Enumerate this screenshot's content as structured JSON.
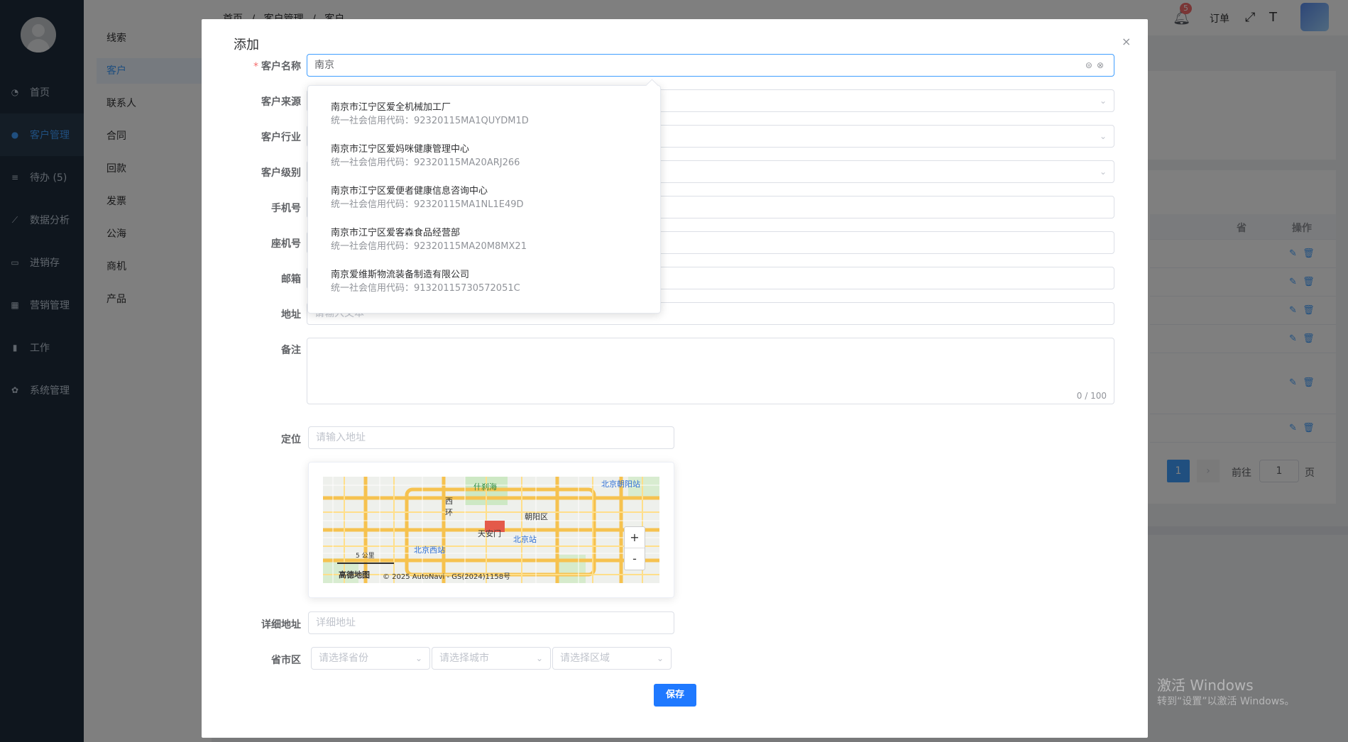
{
  "sidebar": {
    "items": [
      {
        "label": "首页",
        "icon": "dashboard-icon"
      },
      {
        "label": "客户管理",
        "icon": "user-icon"
      },
      {
        "label": "待办 (5)",
        "icon": "sliders-icon"
      },
      {
        "label": "数据分析",
        "icon": "chart-icon"
      },
      {
        "label": "进销存",
        "icon": "box-icon"
      },
      {
        "label": "营销管理",
        "icon": "calculator-icon"
      },
      {
        "label": "工作",
        "icon": "book-icon"
      },
      {
        "label": "系统管理",
        "icon": "gear-icon"
      }
    ]
  },
  "submenu": {
    "items": [
      "线索",
      "客户",
      "联系人",
      "合同",
      "回款",
      "发票",
      "公海",
      "商机",
      "产品"
    ]
  },
  "topbar": {
    "breadcrumb": [
      "首页",
      "/",
      "客户管理",
      "/",
      "客户"
    ],
    "badge": "5",
    "order_label": "订单"
  },
  "table": {
    "col_province": "省",
    "col_action": "操作"
  },
  "pagination": {
    "current": "1",
    "goto_label": "前往",
    "goto_value": "1",
    "unit": "页"
  },
  "watermark": {
    "line1": "激活 Windows",
    "line2": "转到“设置”以激活 Windows。"
  },
  "dialog": {
    "title": "添加",
    "close": "×",
    "fields": {
      "name_label": "客户名称",
      "name_value": "南京",
      "source_label": "客户来源",
      "industry_label": "客户行业",
      "level_label": "客户级别",
      "phone_label": "手机号",
      "landline_label": "座机号",
      "email_label": "邮箱",
      "address_label": "地址",
      "address_placeholder": "请输入文本",
      "remark_label": "备注",
      "remark_counter": "0 / 100",
      "location_label": "定位",
      "location_placeholder": "请输入地址",
      "detail_label": "详细地址",
      "detail_placeholder": "详细地址",
      "region_label": "省市区",
      "province_placeholder": "请选择省份",
      "city_placeholder": "请选择城市",
      "district_placeholder": "请选择区域"
    },
    "save_label": "保存"
  },
  "suggestions": [
    {
      "name": "南京市江宁区爱全机械加工厂",
      "code": "统一社会信用代码：92320115MA1QUYDM1D"
    },
    {
      "name": "南京市江宁区爱妈咪健康管理中心",
      "code": "统一社会信用代码：92320115MA20ARJ266"
    },
    {
      "name": "南京市江宁区爱便者健康信息咨询中心",
      "code": "统一社会信用代码：92320115MA1NL1E49D"
    },
    {
      "name": "南京市江宁区爱客森食品经营部",
      "code": "统一社会信用代码：92320115MA20M8MX21"
    },
    {
      "name": "南京爱维斯物流装备制造有限公司",
      "code": "统一社会信用代码：91320115730572051C"
    }
  ],
  "map": {
    "labels": {
      "shichahai": "什刹海",
      "chaoyang_station": "北京朝阳站",
      "xihuan": "西环",
      "chaoyang": "朝阳区",
      "tiananmen": "天安门",
      "beijing_station": "北京站",
      "beijing_west": "北京西站",
      "scale": "5 公里",
      "brand": "高德地图",
      "copyright": "© 2025 AutoNavi - GS(2024)1158号"
    },
    "zoom_in": "+",
    "zoom_out": "-"
  }
}
